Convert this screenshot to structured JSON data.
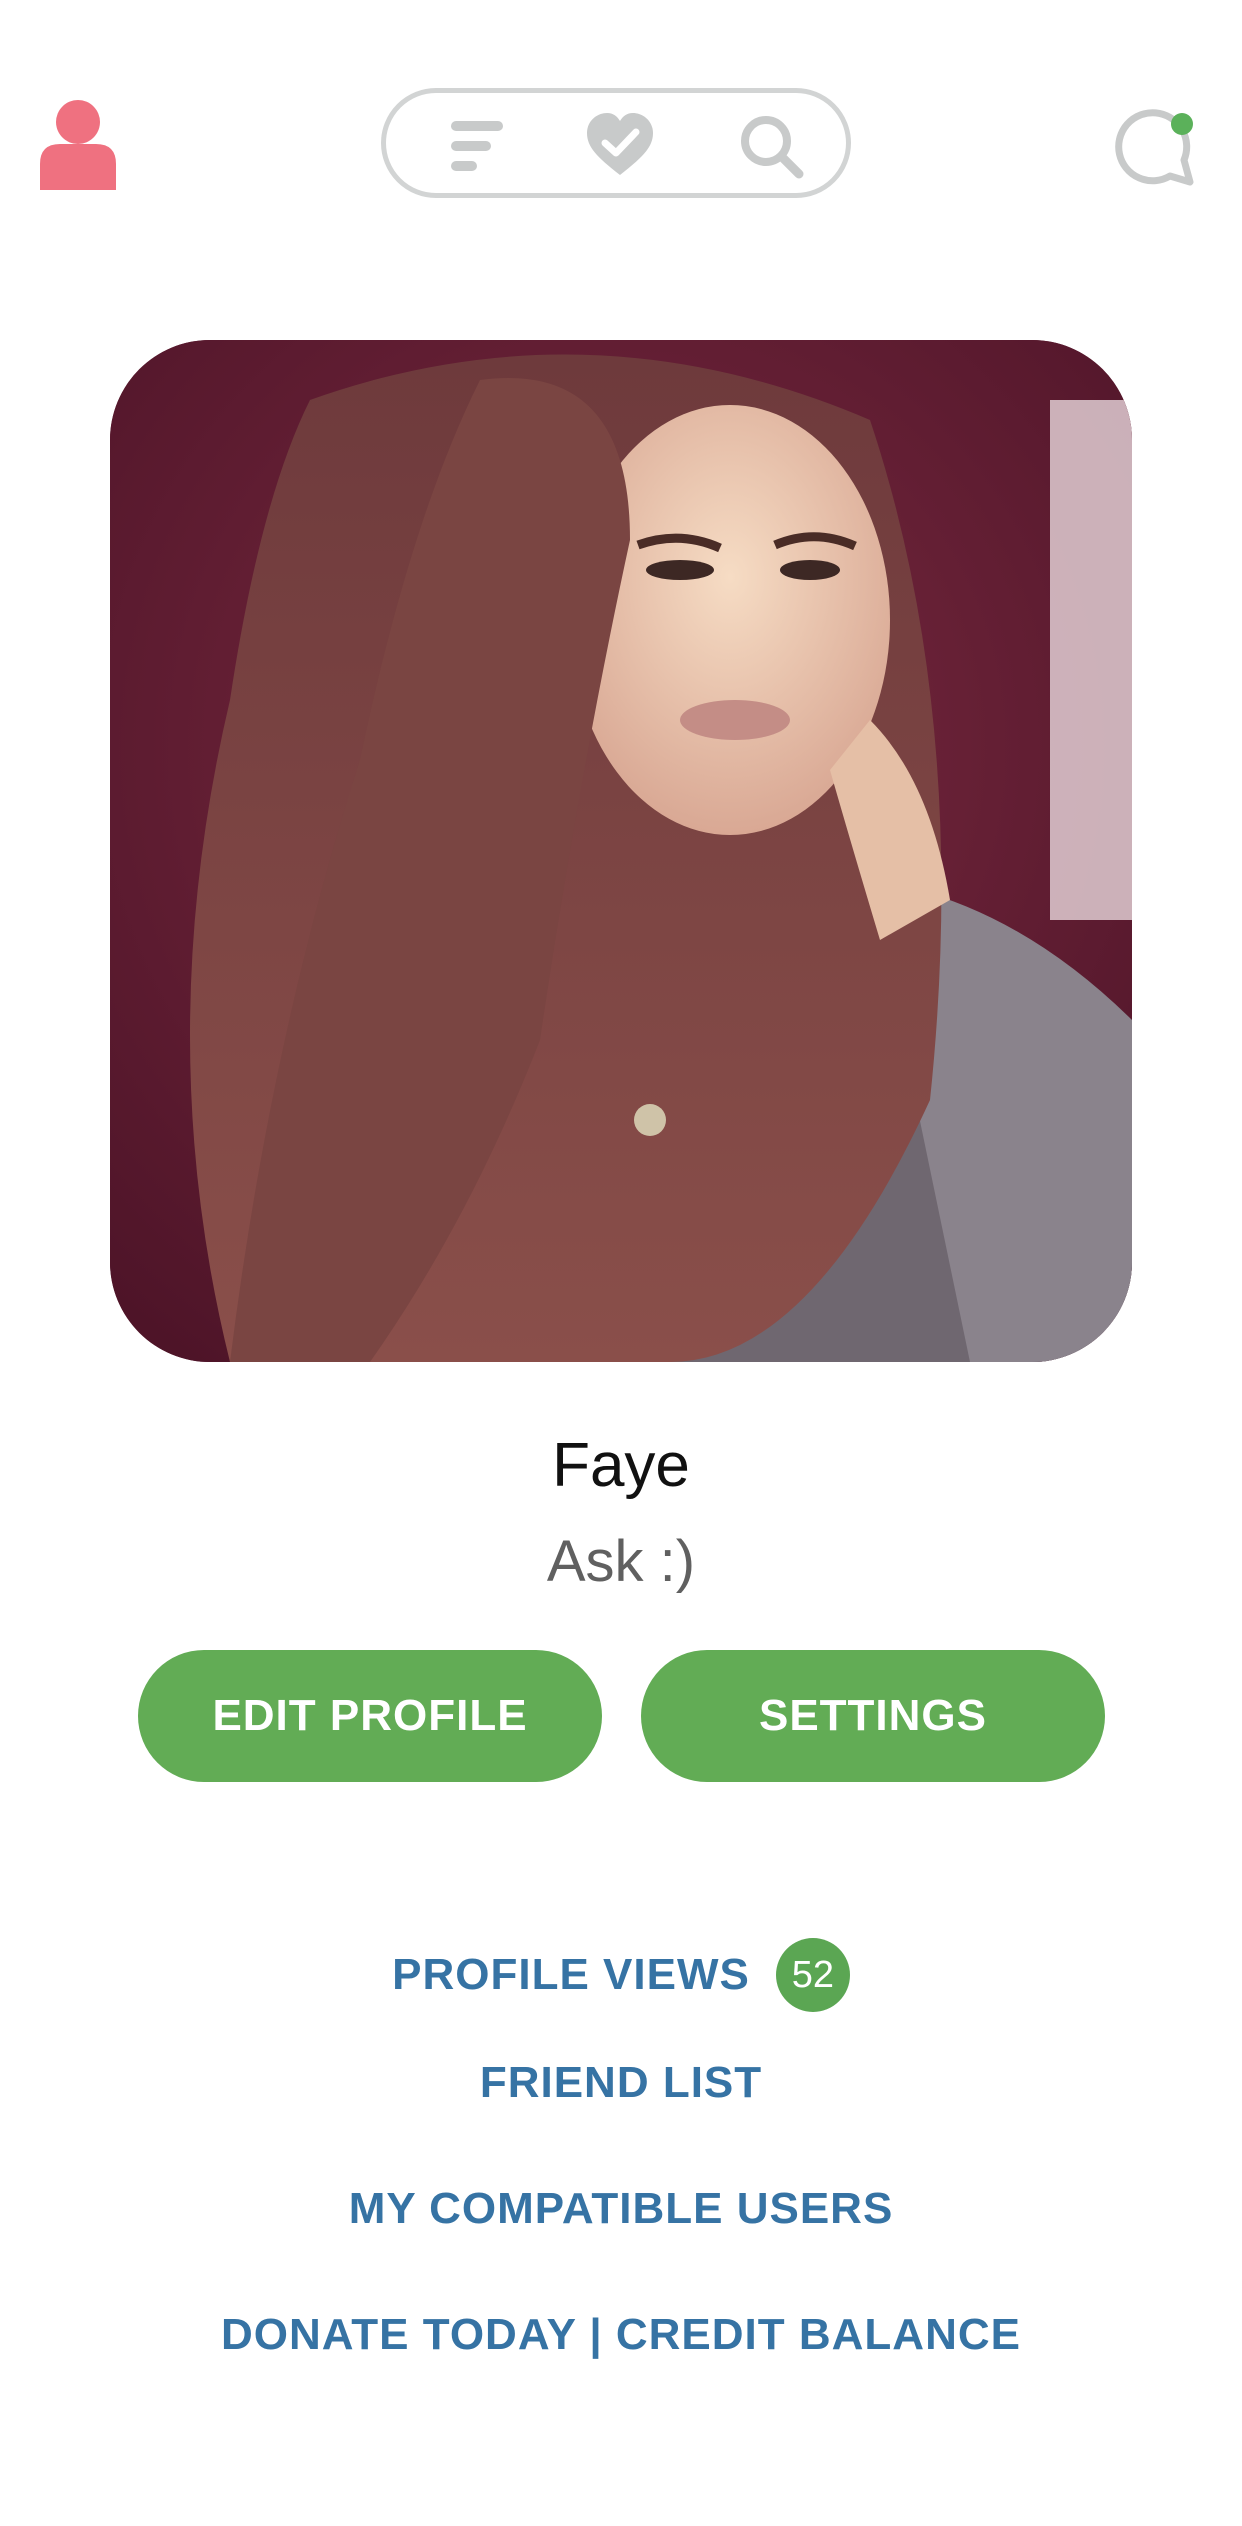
{
  "header": {
    "profile_icon": "person-icon",
    "nav_icons": [
      "menu-icon",
      "heart-check-icon",
      "search-icon"
    ],
    "chat_icon": "chat-bubble-icon",
    "colors": {
      "profile_icon": "#ef7180",
      "nav_icons": "#c8caca",
      "online_dot": "#5bb15a"
    }
  },
  "profile": {
    "name": "Faye",
    "status": "Ask :)"
  },
  "actions": {
    "edit_label": "EDIT PROFILE",
    "settings_label": "SETTINGS",
    "color": "#62ac55"
  },
  "links": {
    "profile_views_label": "PROFILE VIEWS",
    "profile_views_count": "52",
    "friend_list_label": "FRIEND LIST",
    "compatible_label": "MY COMPATIBLE USERS",
    "donate_label": "DONATE TODAY | CREDIT BALANCE",
    "color": "#3673a4"
  }
}
